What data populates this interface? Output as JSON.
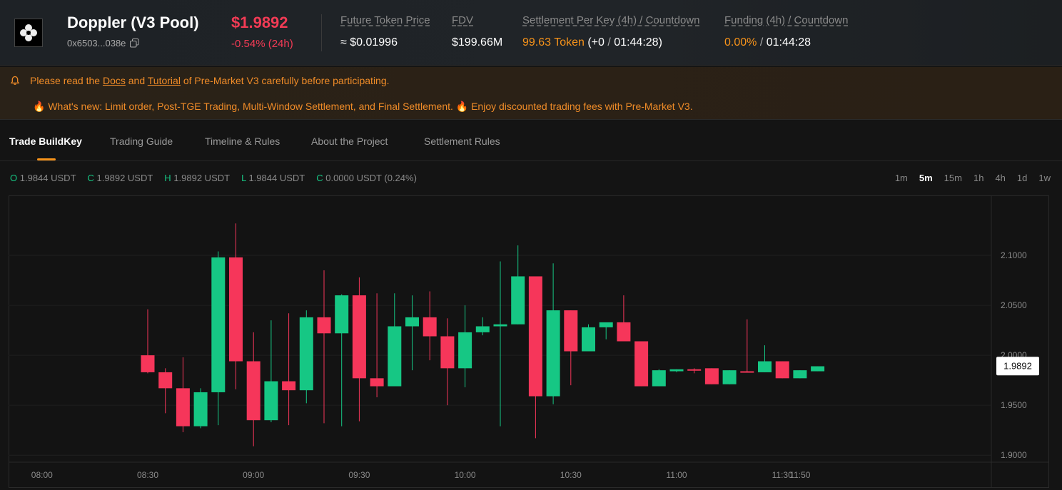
{
  "header": {
    "pool_name": "Doppler (V3 Pool)",
    "address": "0x6503...038e",
    "price": "$1.9892",
    "change": "-0.54% (24h)",
    "future_token_price_label": "Future Token Price",
    "future_token_price_value": "≈ $0.01996",
    "fdv_label": "FDV",
    "fdv_value": "$199.66M",
    "settlement_label": "Settlement Per Key (4h) / Countdown",
    "settlement_token": "99.63 Token",
    "settlement_delta": "(+0",
    "settlement_sep": "/",
    "settlement_countdown": "01:44:28)",
    "funding_label": "Funding (4h) / Countdown",
    "funding_value": "0.00%",
    "funding_sep": "/",
    "funding_countdown": "01:44:28"
  },
  "notice": {
    "l1_pre": "Please read the",
    "docs": "Docs",
    "and": "and",
    "tutorial": "Tutorial",
    "l1_post": "of Pre-Market V3 carefully before participating.",
    "l2": "🔥 What's new: Limit order, Post-TGE Trading, Multi-Window Settlement, and Final Settlement. 🔥 Enjoy discounted trading fees with Pre-Market V3."
  },
  "tabs": [
    "Trade BuildKey",
    "Trading Guide",
    "Timeline & Rules",
    "About the Project",
    "Settlement Rules"
  ],
  "ohlc": {
    "o_key": "O",
    "o_val": "1.9844 USDT",
    "c_key": "C",
    "c_val": "1.9892 USDT",
    "h_key": "H",
    "h_val": "1.9892 USDT",
    "l_key": "L",
    "l_val": "1.9844 USDT",
    "c2_key": "C",
    "c2_val": "0.0000 USDT (0.24%)"
  },
  "intervals": [
    "1m",
    "5m",
    "15m",
    "1h",
    "4h",
    "1d",
    "1w"
  ],
  "selected_interval": "5m",
  "colors": {
    "up": "#16c784",
    "down": "#f6365a",
    "accent": "#f7931a"
  },
  "chart_data": {
    "type": "candlestick",
    "y_ticks": [
      "2.1000",
      "2.0500",
      "2.0000",
      "1.9500",
      "1.9000"
    ],
    "x_ticks": [
      "08:00",
      "08:30",
      "09:00",
      "09:30",
      "10:00",
      "10:30",
      "11:00",
      "11:30",
      "11:50"
    ],
    "last_price_label": "1.9892",
    "ylim": [
      1.893,
      2.16
    ],
    "candles": [
      {
        "o": 2.0,
        "h": 2.046,
        "l": 1.982,
        "c": 1.983
      },
      {
        "o": 1.983,
        "h": 1.987,
        "l": 1.942,
        "c": 1.967
      },
      {
        "o": 1.967,
        "h": 1.998,
        "l": 1.923,
        "c": 1.929
      },
      {
        "o": 1.929,
        "h": 1.967,
        "l": 1.927,
        "c": 1.963
      },
      {
        "o": 1.963,
        "h": 2.104,
        "l": 1.93,
        "c": 2.098
      },
      {
        "o": 2.098,
        "h": 2.132,
        "l": 1.966,
        "c": 1.994
      },
      {
        "o": 1.994,
        "h": 2.023,
        "l": 1.909,
        "c": 1.935
      },
      {
        "o": 1.935,
        "h": 2.035,
        "l": 1.933,
        "c": 1.974
      },
      {
        "o": 1.974,
        "h": 2.042,
        "l": 1.93,
        "c": 1.965
      },
      {
        "o": 1.965,
        "h": 2.045,
        "l": 1.952,
        "c": 2.038
      },
      {
        "o": 2.038,
        "h": 2.085,
        "l": 1.932,
        "c": 2.022
      },
      {
        "o": 2.022,
        "h": 2.061,
        "l": 1.929,
        "c": 2.06
      },
      {
        "o": 2.06,
        "h": 2.078,
        "l": 1.934,
        "c": 1.977
      },
      {
        "o": 1.977,
        "h": 2.062,
        "l": 1.958,
        "c": 1.969
      },
      {
        "o": 1.969,
        "h": 2.062,
        "l": 1.969,
        "c": 2.029
      },
      {
        "o": 2.029,
        "h": 2.06,
        "l": 1.985,
        "c": 2.038
      },
      {
        "o": 2.038,
        "h": 2.064,
        "l": 1.995,
        "c": 2.019
      },
      {
        "o": 2.019,
        "h": 2.037,
        "l": 1.95,
        "c": 1.987
      },
      {
        "o": 1.987,
        "h": 2.05,
        "l": 1.968,
        "c": 2.023
      },
      {
        "o": 2.023,
        "h": 2.038,
        "l": 2.02,
        "c": 2.029
      },
      {
        "o": 2.029,
        "h": 2.094,
        "l": 1.929,
        "c": 2.031
      },
      {
        "o": 2.031,
        "h": 2.11,
        "l": 2.031,
        "c": 2.079
      },
      {
        "o": 2.079,
        "h": 2.079,
        "l": 1.917,
        "c": 1.959
      },
      {
        "o": 1.959,
        "h": 2.092,
        "l": 1.951,
        "c": 2.045
      },
      {
        "o": 2.045,
        "h": 2.045,
        "l": 1.97,
        "c": 2.004
      },
      {
        "o": 2.004,
        "h": 2.031,
        "l": 2.004,
        "c": 2.028
      },
      {
        "o": 2.028,
        "h": 2.028,
        "l": 2.016,
        "c": 2.033
      },
      {
        "o": 2.033,
        "h": 2.06,
        "l": 2.014,
        "c": 2.014
      },
      {
        "o": 2.014,
        "h": 2.014,
        "l": 1.969,
        "c": 1.969
      },
      {
        "o": 1.969,
        "h": 1.986,
        "l": 1.969,
        "c": 1.985
      },
      {
        "o": 1.984,
        "h": 1.986,
        "l": 1.983,
        "c": 1.986
      },
      {
        "o": 1.986,
        "h": 1.987,
        "l": 1.982,
        "c": 1.985
      },
      {
        "o": 1.987,
        "h": 1.987,
        "l": 1.971,
        "c": 1.971
      },
      {
        "o": 1.971,
        "h": 1.985,
        "l": 1.971,
        "c": 1.985
      },
      {
        "o": 1.984,
        "h": 2.036,
        "l": 1.983,
        "c": 1.983
      },
      {
        "o": 1.983,
        "h": 2.01,
        "l": 1.983,
        "c": 1.994
      },
      {
        "o": 1.994,
        "h": 1.994,
        "l": 1.977,
        "c": 1.977
      },
      {
        "o": 1.977,
        "h": 1.985,
        "l": 1.977,
        "c": 1.985
      },
      {
        "o": 1.984,
        "h": 1.989,
        "l": 1.984,
        "c": 1.989
      }
    ]
  }
}
